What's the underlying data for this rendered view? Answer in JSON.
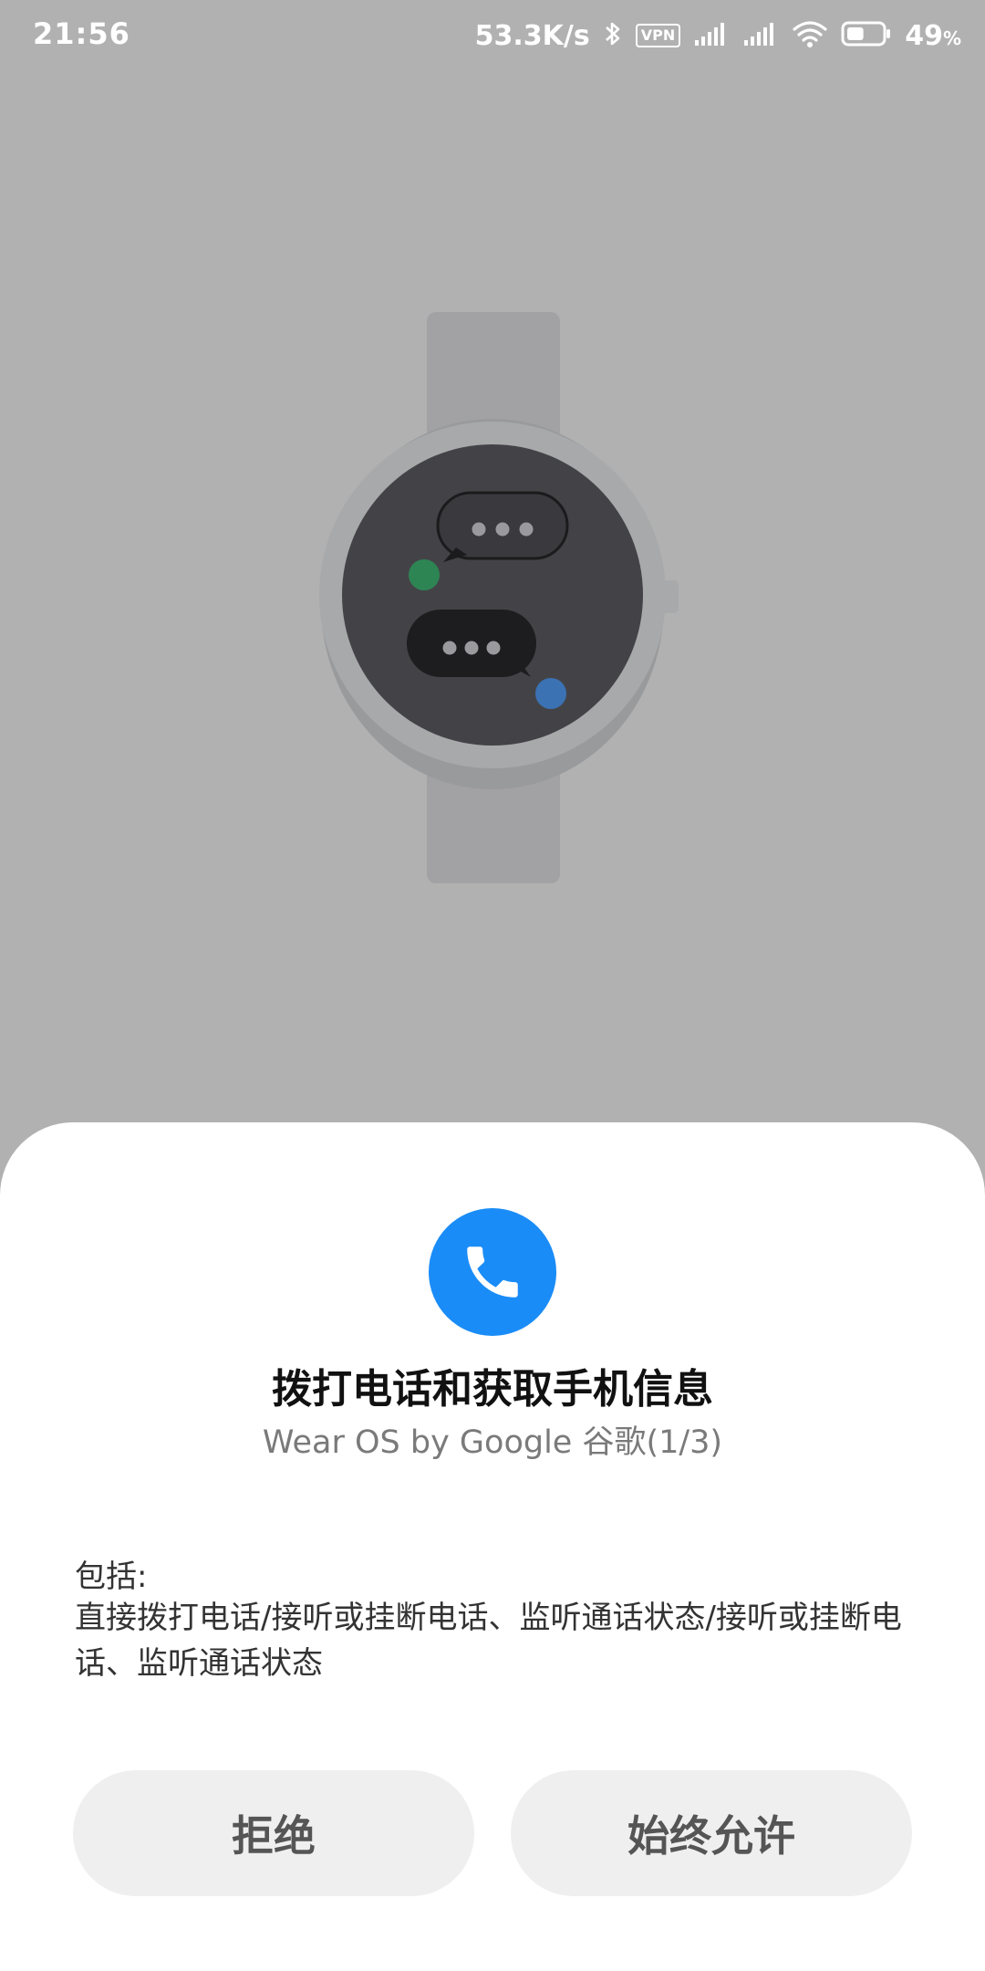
{
  "status_bar": {
    "time": "21:56",
    "network_speed": "53.3K/s",
    "vpn_label": "VPN",
    "battery_percent": "49",
    "battery_unit": "%",
    "battery_level": 0.49,
    "icons": [
      "bluetooth-icon",
      "vpn-icon",
      "signal-icon",
      "signal-icon",
      "wifi-icon",
      "battery-icon"
    ]
  },
  "illustration": {
    "subject": "watch",
    "dots_in_bubbles": 3,
    "accent_colors": [
      "#2e8554",
      "#3b72b3"
    ]
  },
  "dialog": {
    "icon": "phone-icon",
    "icon_color": "#1a8cf7",
    "title": "拨打电话和获取手机信息",
    "subtitle": "Wear OS by Google 谷歌(1/3)",
    "includes_label": "包括:",
    "includes_text": "直接拨打电话/接听或挂断电话、监听通话状态/接听或挂断电话、监听通话状态",
    "buttons": {
      "deny": "拒绝",
      "allow": "始终允许"
    }
  }
}
